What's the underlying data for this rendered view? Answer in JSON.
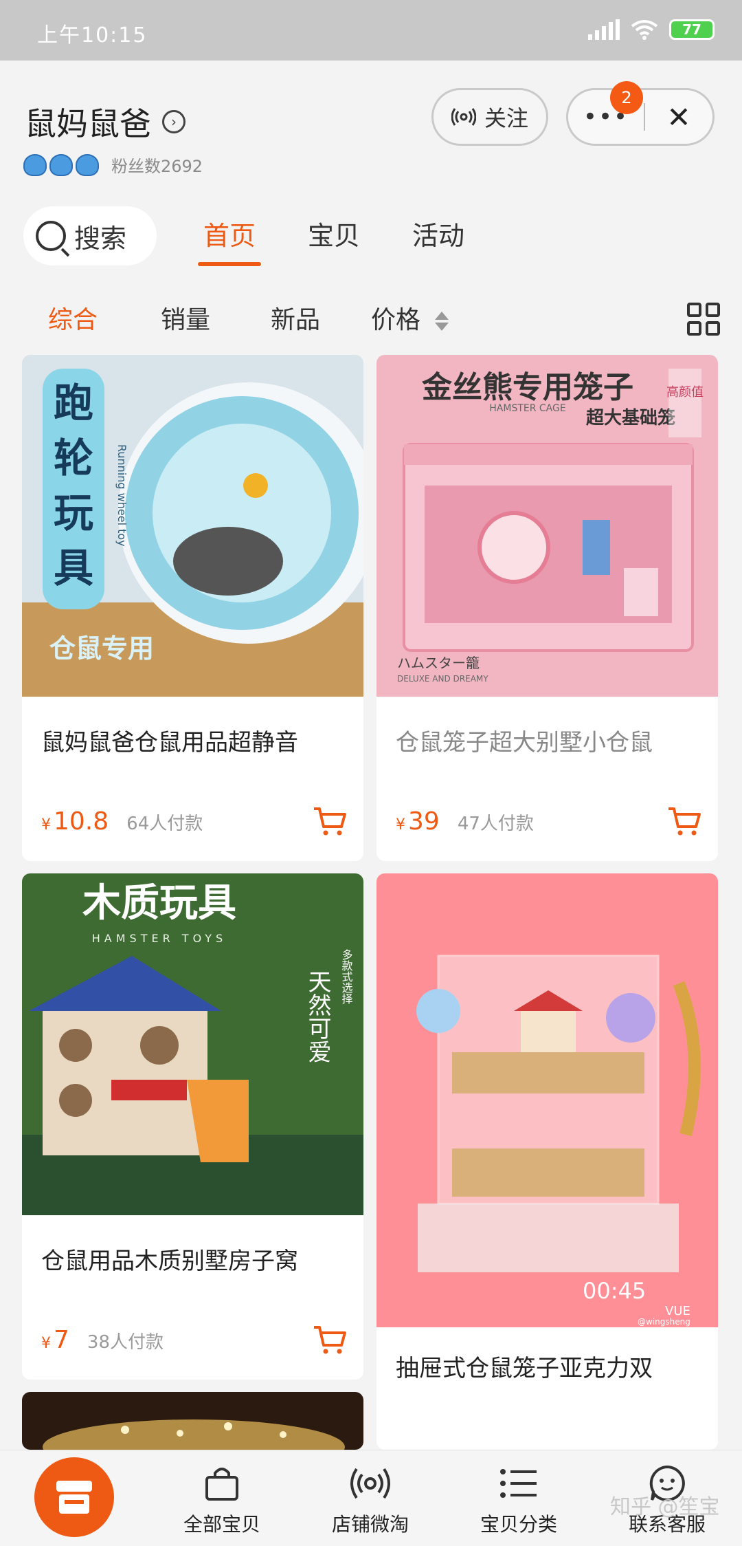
{
  "status": {
    "time": "上午10:15",
    "battery": "77"
  },
  "shop": {
    "name": "鼠妈鼠爸",
    "fans_label": "粉丝数2692",
    "follow_label": "关注",
    "badge_count": "2",
    "more_label": "•••",
    "close_label": "✕"
  },
  "nav": {
    "search_label": "搜索",
    "tabs": [
      {
        "label": "首页",
        "active": true
      },
      {
        "label": "宝贝",
        "active": false
      },
      {
        "label": "活动",
        "active": false
      }
    ]
  },
  "sort": {
    "items": [
      "综合",
      "销量",
      "新品",
      "价格"
    ]
  },
  "products": [
    {
      "title": "鼠妈鼠爸仓鼠用品超静音",
      "currency": "¥",
      "price": "10.8",
      "buyers": "64人付款",
      "image_text": [
        "跑",
        "轮",
        "玩",
        "具",
        "仓鼠专用",
        "Running wheel toy"
      ],
      "image_colors": [
        "#a7d6e6",
        "#c79a5c"
      ]
    },
    {
      "title": "仓鼠笼子超大别墅小仓鼠",
      "currency": "¥",
      "price": "39",
      "buyers": "47人付款",
      "image_text": [
        "金丝熊专用笼子",
        "HAMSTER CAGE",
        "超大基础笼",
        "高颜值",
        "ハムスター籠",
        "DELUXE AND DREAMY"
      ],
      "image_colors": [
        "#f2b6c3",
        "#e98fa4"
      ]
    },
    {
      "title": "仓鼠用品木质别墅房子窝",
      "currency": "¥",
      "price": "7",
      "buyers": "38人付款",
      "image_text": [
        "木质玩具",
        "HAMSTER TOYS",
        "天然可爱",
        "多款式选择"
      ],
      "image_colors": [
        "#5f8a3c",
        "#2b5030"
      ]
    },
    {
      "title": "抽屉式仓鼠笼子亚克力双",
      "currency": "¥",
      "price": "",
      "buyers": "",
      "image_text": [
        "00:45",
        "VUE",
        "@wingsheng"
      ],
      "image_colors": [
        "#ff8f96",
        "#f26f7d"
      ]
    }
  ],
  "bottom_tabs": [
    {
      "label": "全部宝贝",
      "icon": "bag-icon"
    },
    {
      "label": "店铺微淘",
      "icon": "broadcast-icon"
    },
    {
      "label": "宝贝分类",
      "icon": "list-icon"
    },
    {
      "label": "联系客服",
      "icon": "chat-face-icon"
    }
  ],
  "watermark": "知乎 @笙宝"
}
